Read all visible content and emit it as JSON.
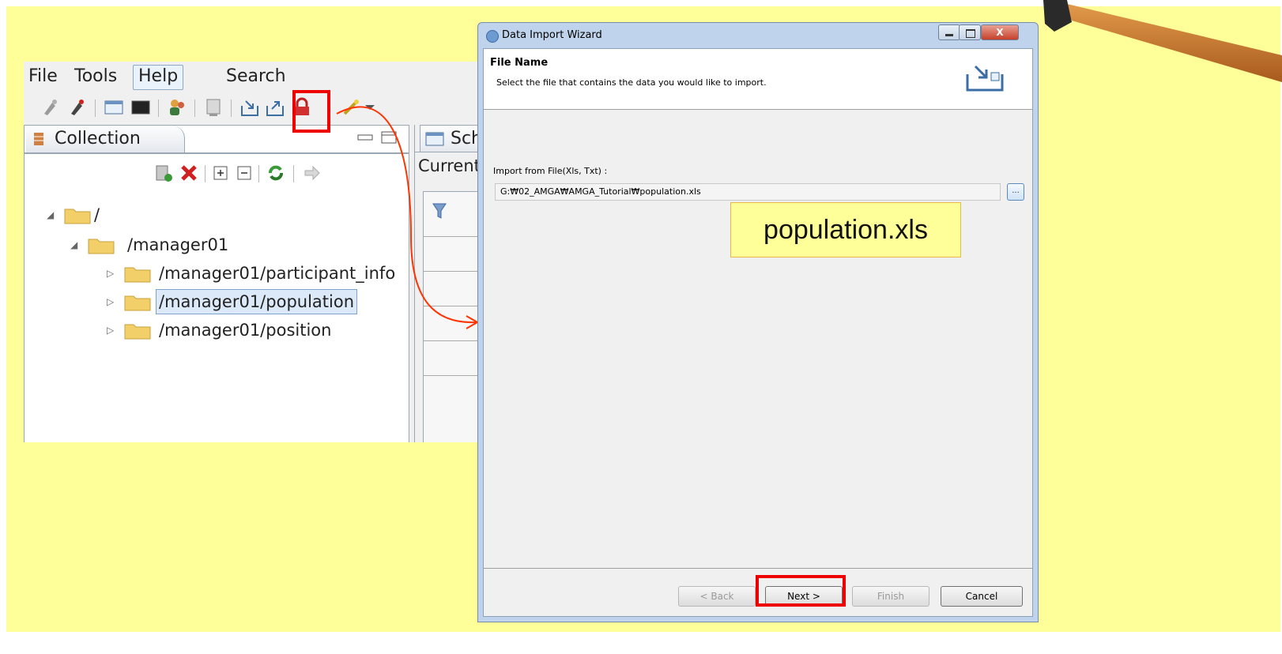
{
  "app": {
    "menu": [
      "File",
      "Tools",
      "Help",
      "Search"
    ],
    "collection_tab": "Collection",
    "schema_tab": "Sch",
    "current_label": "Current",
    "tree": [
      {
        "label": "/",
        "level": 0,
        "expanded": true,
        "selected": false
      },
      {
        "label": "/manager01",
        "level": 1,
        "expanded": true,
        "selected": false
      },
      {
        "label": "/manager01/participant_info",
        "level": 2,
        "expanded": false,
        "selected": false
      },
      {
        "label": "/manager01/population",
        "level": 2,
        "expanded": false,
        "selected": true
      },
      {
        "label": "/manager01/position",
        "level": 2,
        "expanded": false,
        "selected": false
      }
    ]
  },
  "dialog": {
    "title": "Data Import Wizard",
    "close_glyph": "X",
    "header_title": "File Name",
    "header_desc": "Select the file that contains the data you would like to import.",
    "field_label": "Import from File(Xls, Txt) :",
    "field_value": "G:₩02_AMGA₩AMGA_Tutorial₩population.xls",
    "browse_label": "...",
    "callout": "population.xls",
    "buttons": {
      "back": "< Back",
      "next": "Next >",
      "finish": "Finish",
      "cancel": "Cancel"
    }
  },
  "colors": {
    "slide_bg": "#ffff99",
    "highlight": "#ee0000",
    "arrow": "#ff3300"
  }
}
